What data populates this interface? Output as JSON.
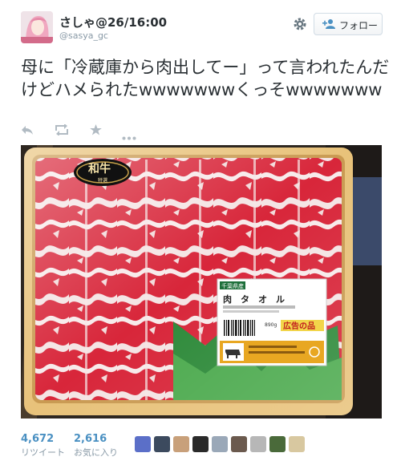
{
  "tweet": {
    "display_name": "さしゃ@26/16:00",
    "handle": "@sasya_gc",
    "follow_label": "フォロー",
    "text": "母に「冷蔵庫から肉出してー」って言われたんだけどハメられたwwwwwwwくっそwwwwwww"
  },
  "actions": [
    "reply-icon",
    "retweet-icon",
    "favorite-icon",
    "more-icon"
  ],
  "photo": {
    "brand_label": "和牛",
    "brand_sub": "特選",
    "sticker_tag": "千葉県産",
    "sticker_product": "肉　タ　オ　ル",
    "sticker_weight": "890g",
    "sticker_ad": "広告の品"
  },
  "stats": {
    "retweets_count": "4,672",
    "retweets_label": "リツイート",
    "favorites_count": "2,616",
    "favorites_label": "お気に入り"
  },
  "favoriters": [
    "#5b6fc8",
    "#3c4a5e",
    "#c8a07a",
    "#2a2a2a",
    "#9aa8b8",
    "#6b5a4e",
    "#b7b7b7",
    "#4a6a3a",
    "#d8c8a0"
  ],
  "colors": {
    "link": "#4a90c2",
    "text": "#292f33",
    "muted": "#8899a6"
  }
}
